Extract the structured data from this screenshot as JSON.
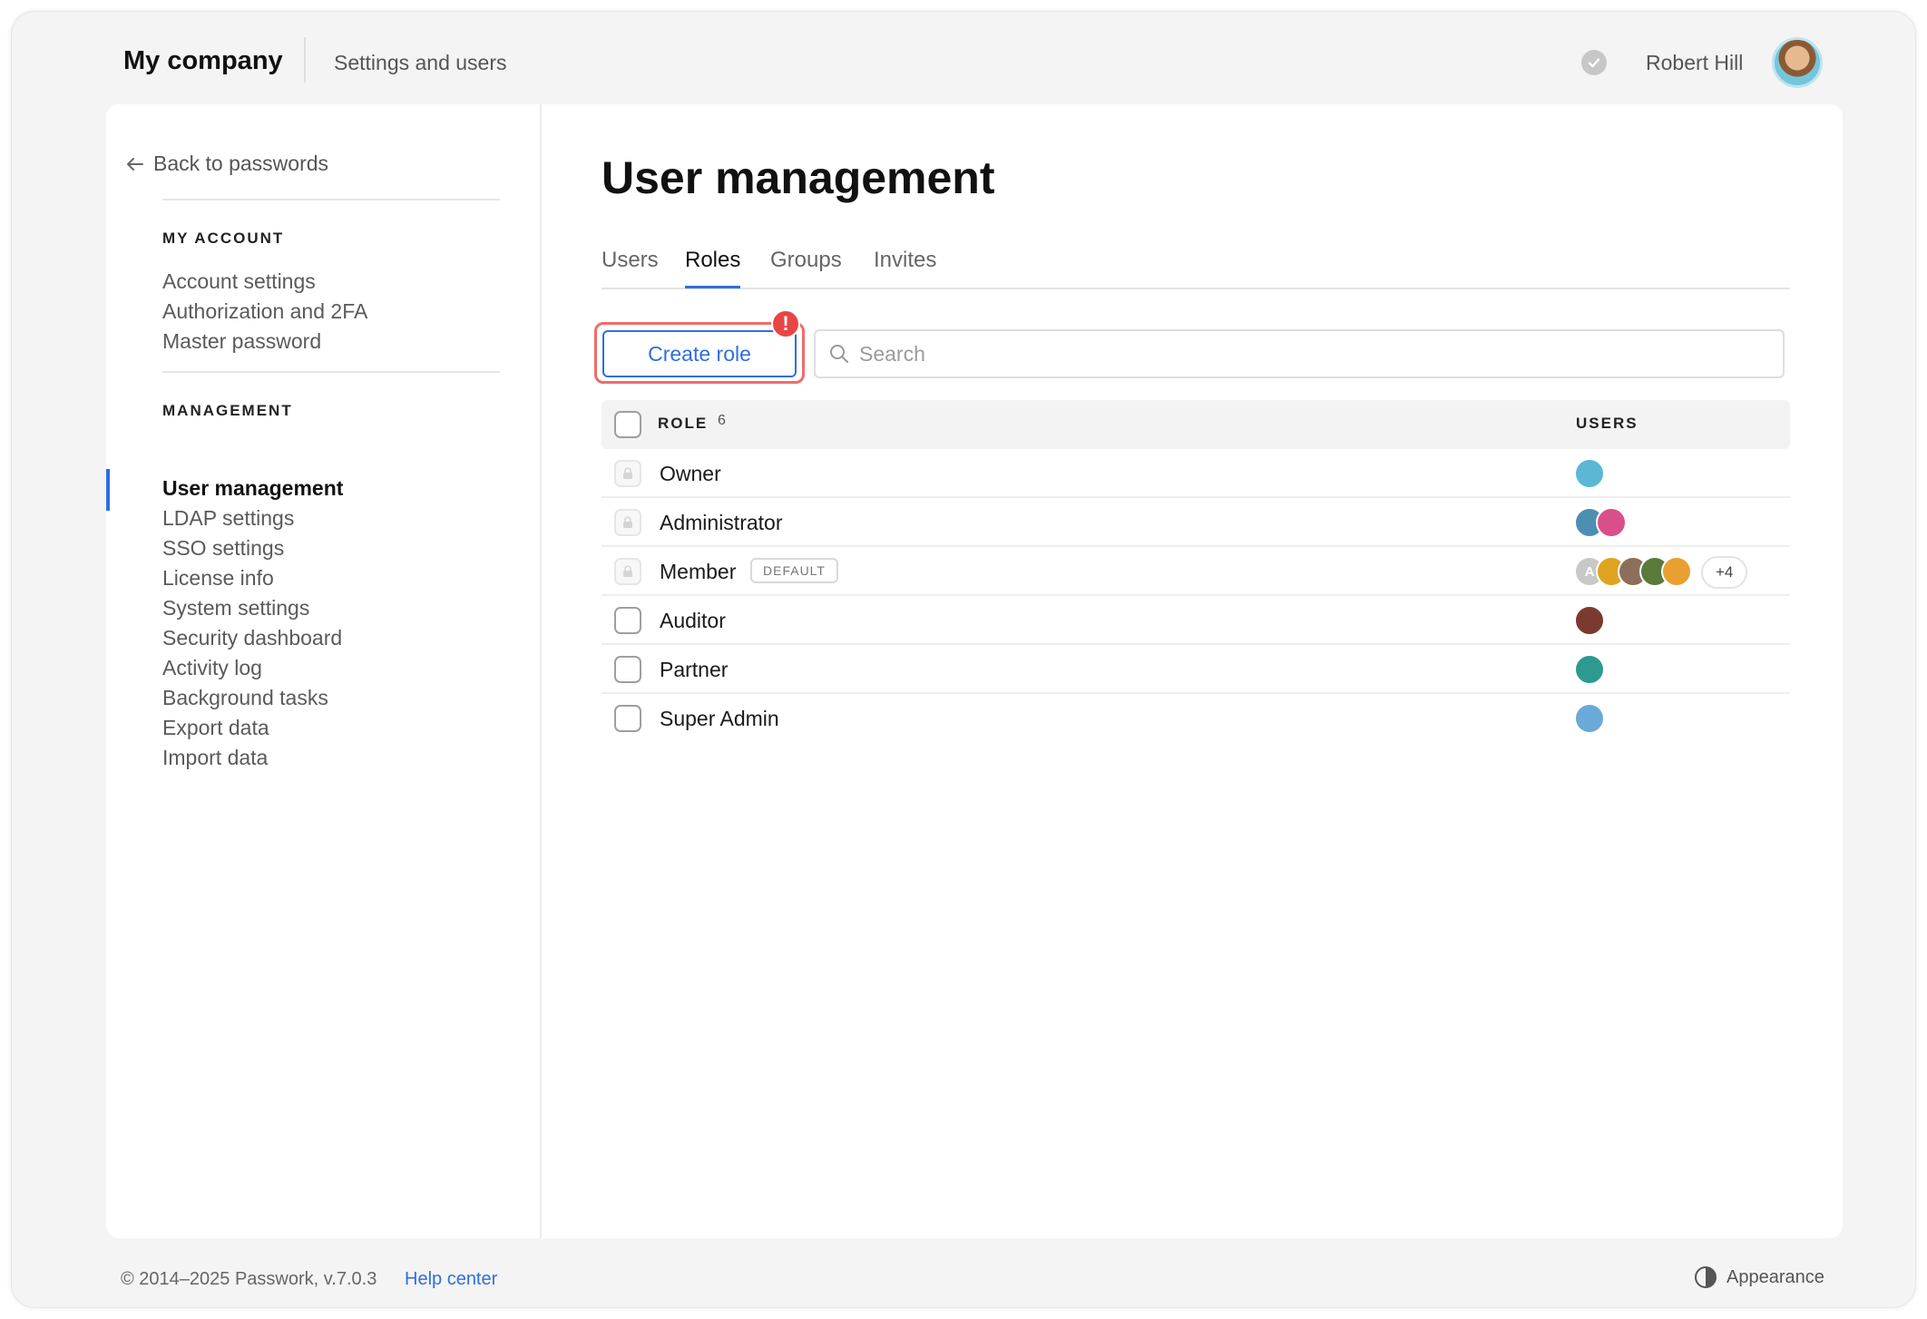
{
  "header": {
    "company": "My company",
    "section": "Settings and users",
    "user_name": "Robert Hill"
  },
  "sidebar": {
    "back_label": "Back to passwords",
    "my_account_heading": "MY ACCOUNT",
    "my_account_items": [
      "Account settings",
      "Authorization and 2FA",
      "Master password"
    ],
    "management_heading": "MANAGEMENT",
    "management_items": [
      "User management",
      "LDAP settings",
      "SSO settings",
      "License info",
      "System settings",
      "Security dashboard",
      "Activity log",
      "Background tasks",
      "Export data",
      "Import data"
    ],
    "active_item": "User management"
  },
  "main": {
    "title": "User management",
    "tabs": [
      "Users",
      "Roles",
      "Groups",
      "Invites"
    ],
    "active_tab": "Roles",
    "create_button": "Create role",
    "alert_mark": "!",
    "search_placeholder": "Search"
  },
  "table": {
    "headers": {
      "role": "ROLE",
      "count": "6",
      "users": "USERS"
    },
    "rows": [
      {
        "role": "Owner",
        "locked": true,
        "badge": "",
        "avatar_colors": [
          "#5bb7d6"
        ]
      },
      {
        "role": "Administrator",
        "locked": true,
        "badge": "",
        "avatar_colors": [
          "#4d8fb3",
          "#d94f8a"
        ]
      },
      {
        "role": "Member",
        "locked": true,
        "badge": "DEFAULT",
        "avatar_letter": "A",
        "avatar_colors": [
          "#e0a321",
          "#8d6e5a",
          "#5a7a3a",
          "#e8a030"
        ],
        "more": "+4"
      },
      {
        "role": "Auditor",
        "locked": false,
        "badge": "",
        "avatar_colors": [
          "#7a3b2e"
        ]
      },
      {
        "role": "Partner",
        "locked": false,
        "badge": "",
        "avatar_colors": [
          "#2e9a8f"
        ]
      },
      {
        "role": "Super Admin",
        "locked": false,
        "badge": "",
        "avatar_colors": [
          "#6aa9d8"
        ]
      }
    ]
  },
  "footer": {
    "copyright": "© 2014–2025 Passwork, v.7.0.3",
    "help": "Help center",
    "appearance": "Appearance"
  },
  "colors": {
    "accent": "#2f6ee0",
    "alert": "#e94545",
    "highlight_border": "#f06b6b"
  },
  "icons": {
    "back": "arrow-left-icon",
    "status": "check-circle-icon",
    "search": "search-icon",
    "lock": "lock-icon",
    "appearance": "half-circle-contrast-icon"
  }
}
